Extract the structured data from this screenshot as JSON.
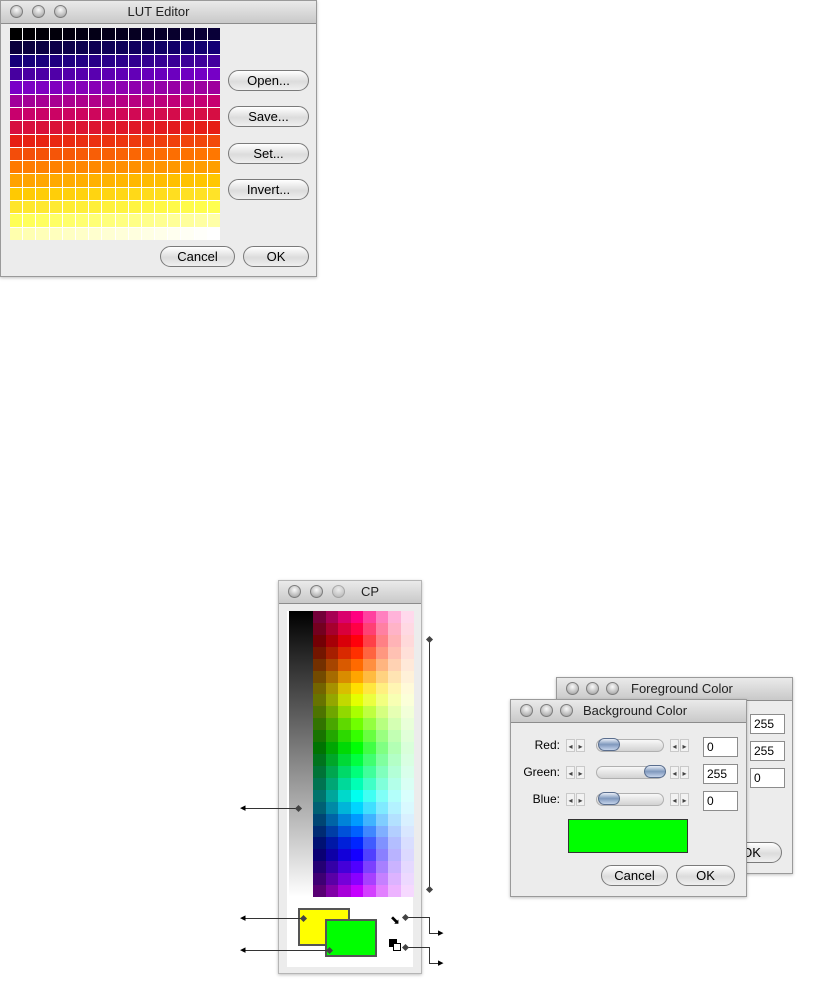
{
  "lut_editor": {
    "title": "LUT Editor",
    "open_label": "Open...",
    "save_label": "Save...",
    "set_label": "Set...",
    "invert_label": "Invert...",
    "cancel_label": "Cancel",
    "ok_label": "OK"
  },
  "cp": {
    "title": "CP"
  },
  "foreground_color": {
    "title": "Foreground Color",
    "red_value": "255",
    "green_value": "255",
    "blue_value": "0",
    "ok_label": "OK"
  },
  "background_color": {
    "title": "Background Color",
    "red_label": "Red:",
    "green_label": "Green:",
    "blue_label": "Blue:",
    "red_value": "0",
    "green_value": "255",
    "blue_value": "0",
    "swatch_color": "#00ff00",
    "cancel_label": "Cancel",
    "ok_label": "OK"
  },
  "colors": {
    "foreground_swatch": "#ffff00",
    "background_swatch": "#00ff00"
  }
}
